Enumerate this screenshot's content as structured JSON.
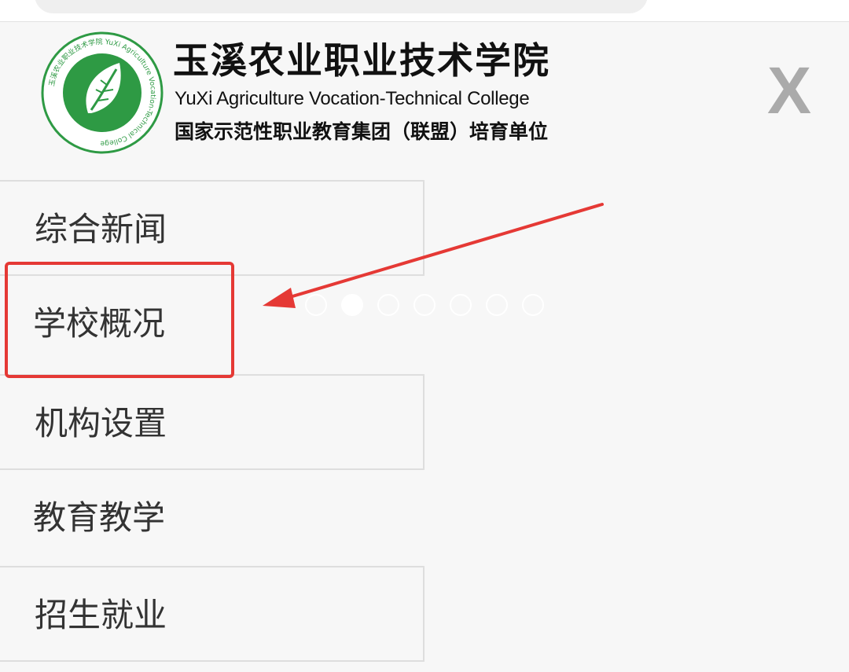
{
  "header": {
    "logo_title": "玉溪农业职业技术学院",
    "logo_english": "YuXi Agriculture Vocation-Technical College",
    "logo_subtitle": "国家示范性职业教育集团（联盟）培育单位",
    "logo_ring_text": "玉溪农业职业技术学院 YuXi Agriculture Vocation-Technical College",
    "close_label": "X"
  },
  "menu": {
    "items": [
      {
        "label": "综合新闻"
      },
      {
        "label": "学校概况"
      },
      {
        "label": "机构设置"
      },
      {
        "label": "教育教学"
      },
      {
        "label": "招生就业"
      }
    ]
  },
  "slider": {
    "dot_count": 7,
    "active_index": 1
  },
  "colors": {
    "annotation_red": "#e53935",
    "logo_green": "#2e9a44",
    "close_gray": "#aaaaaa",
    "menu_text": "#333333"
  },
  "icons": {
    "close": "close-icon",
    "logo": "leaf-emblem-icon",
    "annotation": "red-arrow-icon"
  }
}
